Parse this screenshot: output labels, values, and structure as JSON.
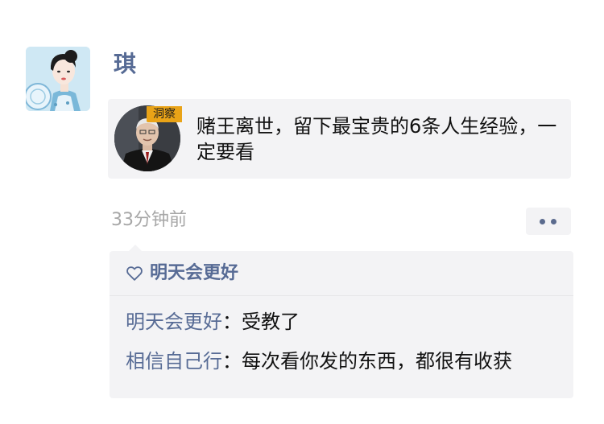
{
  "post": {
    "username": "琪",
    "avatar_icon": "woman-portrait-avatar",
    "link_card": {
      "thumbnail_icon": "elderly-man-portrait-thumbnail",
      "tag": "洞察",
      "title": "赌王离世，留下最宝贵的6条人生经验，一定要看"
    },
    "time": "33分钟前",
    "more_icon": "more-dots-icon"
  },
  "interactions": {
    "like_icon": "heart-icon",
    "likes": [
      "明天会更好"
    ],
    "comments": [
      {
        "author": "明天会更好",
        "separator": "：",
        "text": "受教了"
      },
      {
        "author": "相信自己行",
        "separator": "：",
        "text": "每次看你发的东西，都很有收获"
      }
    ]
  },
  "colors": {
    "name_blue": "#576b95",
    "background_gray": "#f3f3f5",
    "tag_orange": "#e9a317",
    "time_gray": "#a7a7a7"
  }
}
